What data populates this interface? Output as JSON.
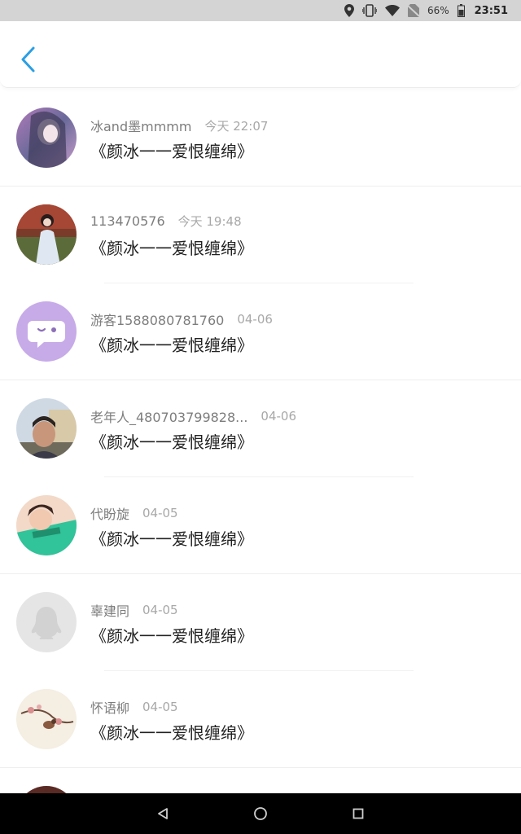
{
  "status_bar": {
    "battery_percent": "66%",
    "time": "23:51",
    "icons": [
      "location-icon",
      "vibrate-icon",
      "wifi-icon",
      "no-sim-icon",
      "battery-icon"
    ]
  },
  "header": {
    "back_icon": "chevron-left-icon",
    "accent_color": "#2a9ee4"
  },
  "items": [
    {
      "name": "冰and墨mmmm",
      "time": "今天 22:07",
      "title": "《颜冰一一爱恨缠绵》",
      "avatar": "photo-avatar"
    },
    {
      "name": "113470576",
      "time": "今天 19:48",
      "title": "《颜冰一一爱恨缠绵》",
      "avatar": "photo-avatar"
    },
    {
      "name": "游客1588080781760",
      "time": "04-06",
      "title": "《颜冰一一爱恨缠绵》",
      "avatar": "guest-chat-avatar"
    },
    {
      "name": "老年人_480703799828...",
      "time": "04-06",
      "title": "《颜冰一一爱恨缠绵》",
      "avatar": "photo-avatar"
    },
    {
      "name": "代盼旋",
      "time": "04-05",
      "title": "《颜冰一一爱恨缠绵》",
      "avatar": "photo-avatar"
    },
    {
      "name": "辜建同",
      "time": "04-05",
      "title": "《颜冰一一爱恨缠绵》",
      "avatar": "default-penguin-avatar"
    },
    {
      "name": "怀语柳",
      "time": "04-05",
      "title": "《颜冰一一爱恨缠绵》",
      "avatar": "painting-avatar"
    }
  ],
  "nav_bar": {
    "buttons": [
      "back-triangle-icon",
      "home-circle-icon",
      "recents-square-icon"
    ]
  }
}
